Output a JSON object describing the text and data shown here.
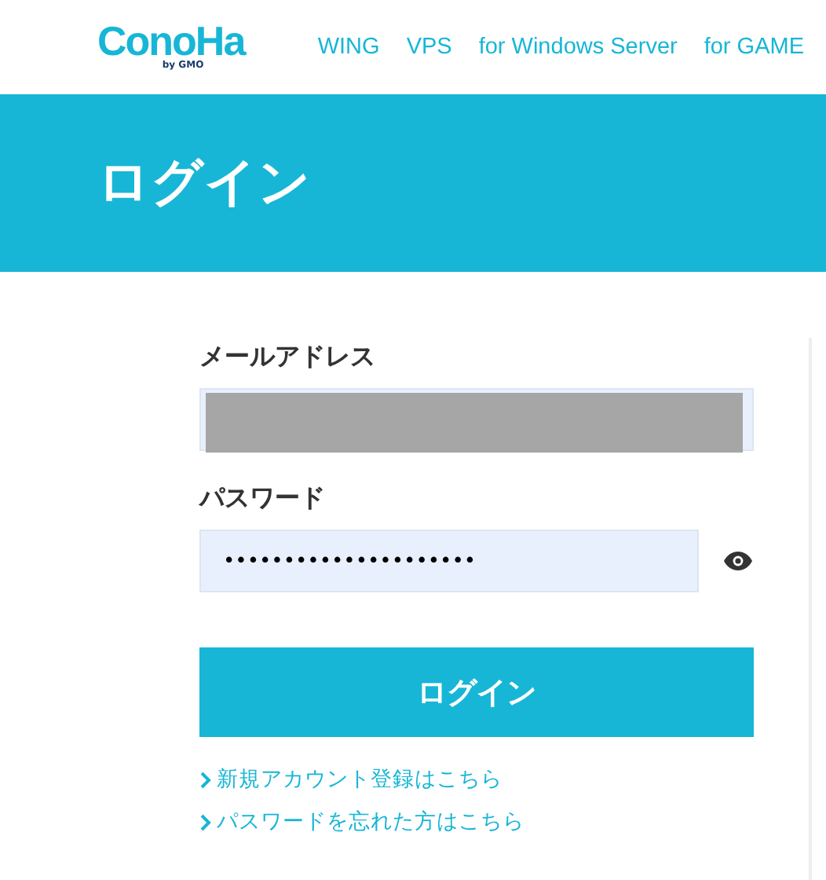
{
  "header": {
    "logo": {
      "name": "ConoHa",
      "byline": "by GMO"
    },
    "nav": [
      {
        "label": "WING"
      },
      {
        "label": "VPS"
      },
      {
        "label": "for Windows Server"
      },
      {
        "label": "for GAME"
      }
    ]
  },
  "banner": {
    "title": "ログイン"
  },
  "form": {
    "email": {
      "label": "メールアドレス",
      "redacted": true
    },
    "password": {
      "label": "パスワード",
      "value": "•••••••••••••••••••••"
    },
    "submit": "ログイン",
    "links": [
      {
        "label": "新規アカウント登録はこちら"
      },
      {
        "label": "パスワードを忘れた方はこちら"
      }
    ]
  }
}
